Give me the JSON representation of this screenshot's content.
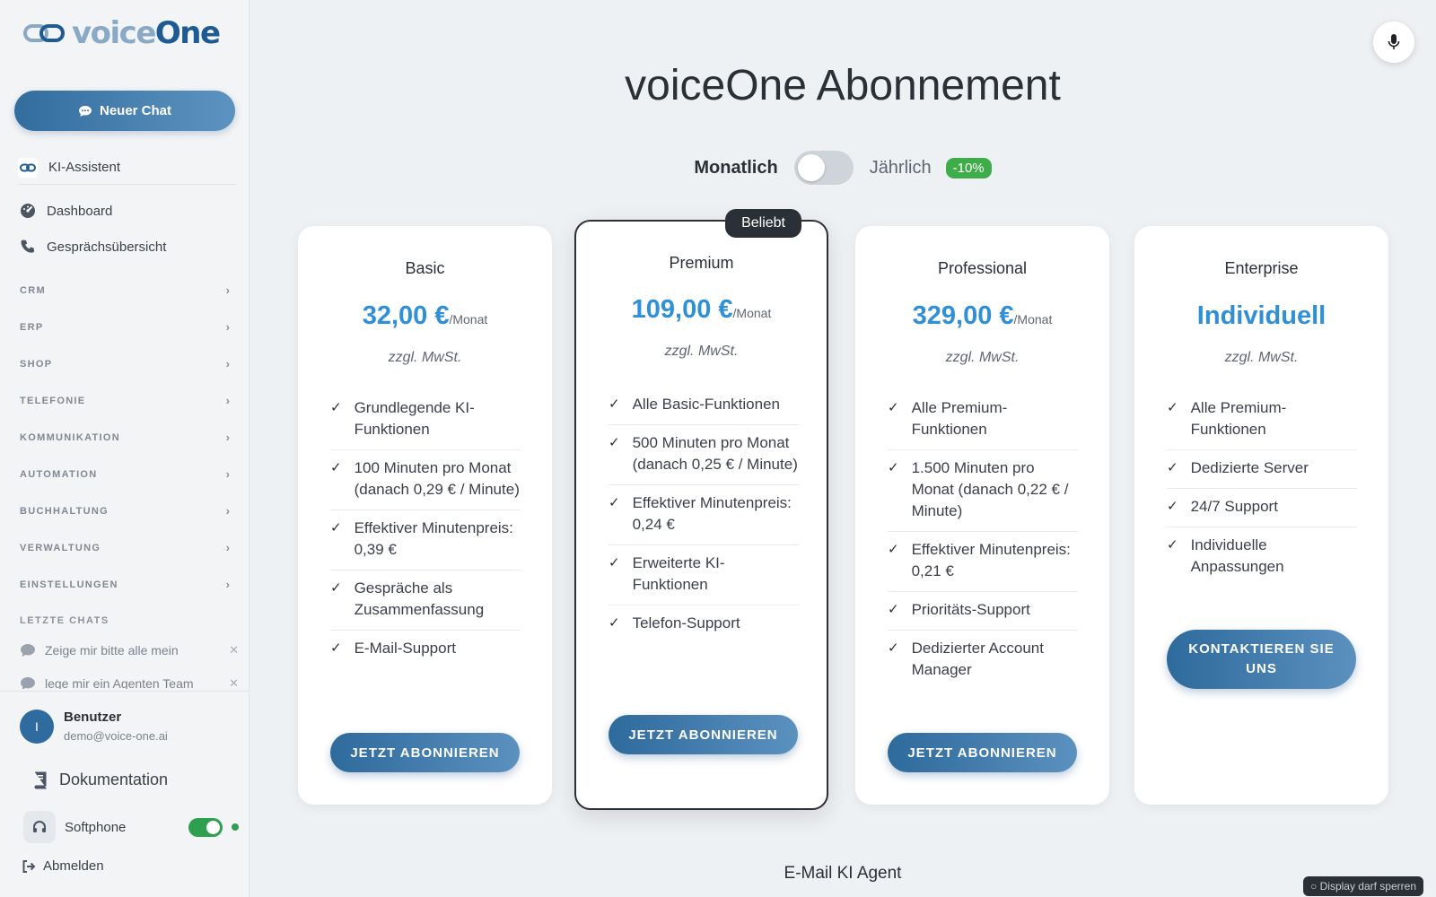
{
  "sidebar": {
    "logo": {
      "part1": "voice",
      "part2": "One"
    },
    "new_chat_label": "Neuer Chat",
    "ki_assistant_label": "KI-Assistent",
    "nav": {
      "dashboard": "Dashboard",
      "calls": "Gesprächsübersicht"
    },
    "sections": [
      "CRM",
      "ERP",
      "SHOP",
      "TELEFONIE",
      "KOMMUNIKATION",
      "AUTOMATION",
      "BUCHHALTUNG",
      "VERWALTUNG",
      "EINSTELLUNGEN"
    ],
    "recent_chats_heading": "LETZTE CHATS",
    "recent_chats": [
      "Zeige mir bitte alle mein",
      "lege mir ein Agenten Team"
    ],
    "user": {
      "initial": "I",
      "name": "Benutzer",
      "email": "demo@voice-one.ai"
    },
    "documentation_label": "Dokumentation",
    "softphone_label": "Softphone",
    "softphone_enabled": true,
    "logout_label": "Abmelden"
  },
  "main": {
    "title": "voiceOne Abonnement",
    "billing": {
      "monthly_label": "Monatlich",
      "yearly_label": "Jährlich",
      "discount": "-10%",
      "selected": "Monatlich"
    },
    "plans": [
      {
        "name": "Basic",
        "price": "32,00 €",
        "period": "/Monat",
        "vat": "zzgl. MwSt.",
        "features": [
          "Grundlegende KI-Funktionen",
          "100 Minuten pro Monat (danach 0,29 € / Minute)",
          "Effektiver Minutenpreis: 0,39 €",
          "Gespräche als Zusammenfassung",
          "E-Mail-Support"
        ],
        "cta": "JETZT ABONNIEREN"
      },
      {
        "name": "Premium",
        "badge": "Beliebt",
        "price": "109,00 €",
        "period": "/Monat",
        "vat": "zzgl. MwSt.",
        "features": [
          "Alle Basic-Funktionen",
          "500 Minuten pro Monat (danach 0,25 € / Minute)",
          "Effektiver Minutenpreis: 0,24 €",
          "Erweiterte KI-Funktionen",
          "Telefon-Support"
        ],
        "cta": "JETZT ABONNIEREN"
      },
      {
        "name": "Professional",
        "price": "329,00 €",
        "period": "/Monat",
        "vat": "zzgl. MwSt.",
        "features": [
          "Alle Premium-Funktionen",
          "1.500 Minuten pro Monat (danach 0,22 € / Minute)",
          "Effektiver Minutenpreis: 0,21 €",
          "Prioritäts-Support",
          "Dedizierter Account Manager"
        ],
        "cta": "JETZT ABONNIEREN"
      },
      {
        "name": "Enterprise",
        "price": "Individuell",
        "vat": "zzgl. MwSt.",
        "features": [
          "Alle Premium-Funktionen",
          "Dedizierte Server",
          "24/7 Support",
          "Individuelle Anpassungen"
        ],
        "cta": "KONTAKTIEREN SIE UNS"
      }
    ],
    "next_section_title": "E-Mail KI Agent",
    "display_lock_note": "○ Display darf sperren"
  },
  "colors": {
    "accent": "#2f8fd8",
    "button_gradient_start": "#2e6a9c",
    "button_gradient_end": "#5b91bf",
    "discount_badge": "#3eac48",
    "toggle_on": "#2e9e4f"
  },
  "icons": {
    "mic": "microphone-icon",
    "dashboard": "dashboard-gauge-icon",
    "calls": "phone-icon",
    "chat": "chat-bubble-icon",
    "docs": "book-icon",
    "softphone": "headset-icon",
    "logout": "logout-icon"
  }
}
